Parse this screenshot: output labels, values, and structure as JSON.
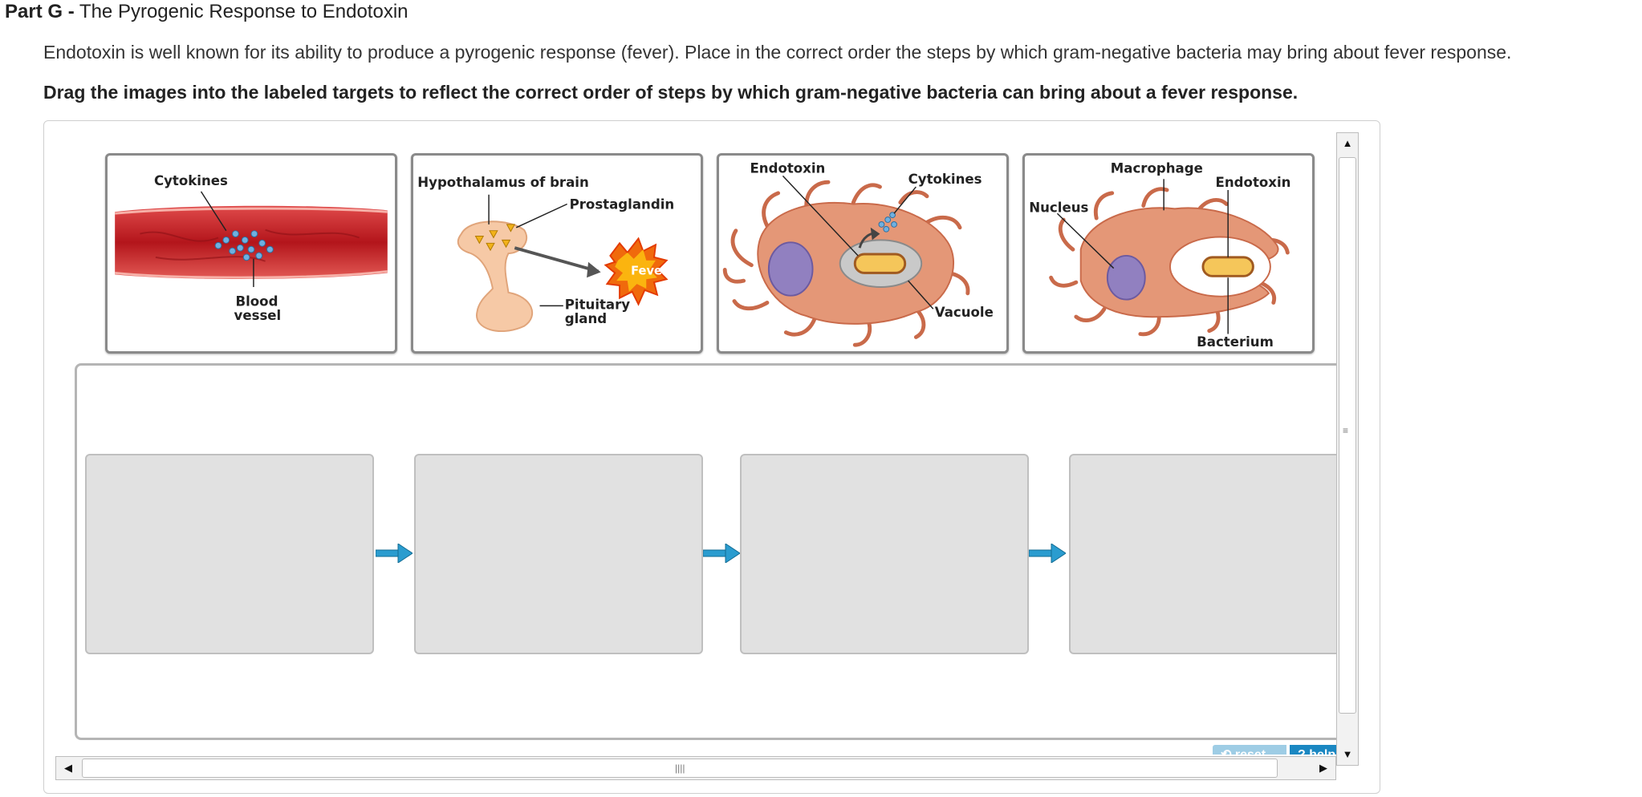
{
  "header": {
    "part_label": "Part G -",
    "part_title": "The Pyrogenic Response to Endotoxin"
  },
  "intro_text": "Endotoxin is well known for its ability to produce a pyrogenic response (fever). Place in the correct order the steps by which gram-negative bacteria may bring about fever response.",
  "instruction_text": "Drag the images into the labeled targets to reflect the correct order of steps by which gram-negative bacteria can bring about a fever response.",
  "cards": [
    {
      "labels": {
        "cytokines": "Cytokines",
        "blood_vessel_1": "Blood",
        "blood_vessel_2": "vessel"
      }
    },
    {
      "labels": {
        "hypothalamus": "Hypothalamus of brain",
        "prostaglandin": "Prostaglandin",
        "fever": "Fever",
        "pituitary_1": "Pituitary",
        "pituitary_2": "gland"
      }
    },
    {
      "labels": {
        "endotoxin": "Endotoxin",
        "cytokines": "Cytokines",
        "vacuole": "Vacuole"
      }
    },
    {
      "labels": {
        "macrophage": "Macrophage",
        "endotoxin": "Endotoxin",
        "nucleus": "Nucleus",
        "bacterium": "Bacterium"
      }
    }
  ],
  "targets_count": 4,
  "controls": {
    "reset_label": "reset",
    "help_label": "help"
  },
  "colors": {
    "arrow": "#2a9ccf",
    "target_bg": "#e1e1e1",
    "help_bg": "#1a87c2",
    "reset_bg": "#9ecde5"
  }
}
